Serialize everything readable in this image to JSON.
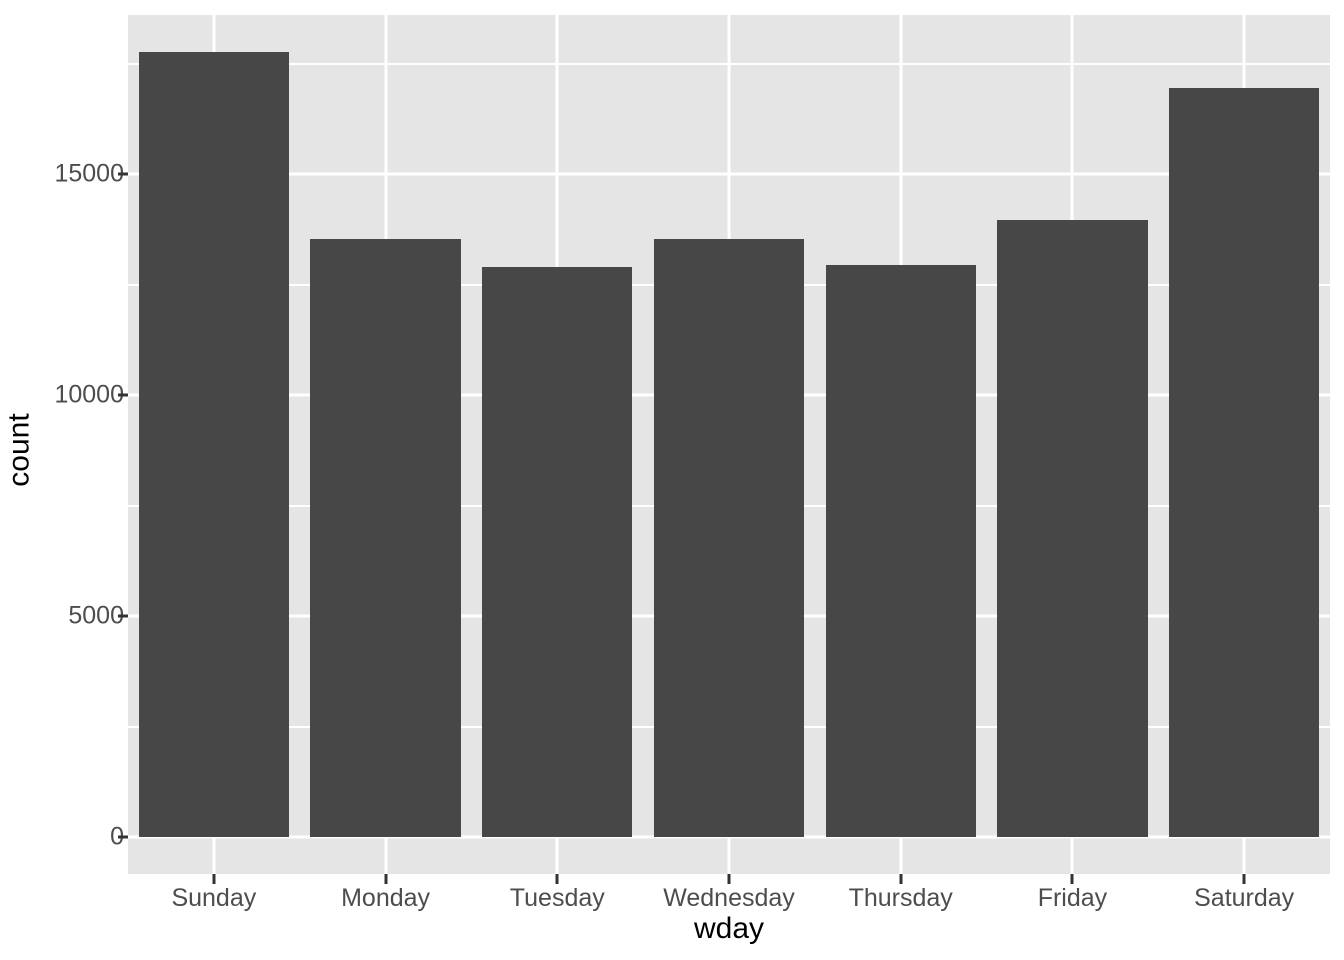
{
  "chart_data": {
    "type": "bar",
    "title": "",
    "subtitle": "",
    "xlabel": "wday",
    "ylabel": "count",
    "categories": [
      "Sunday",
      "Monday",
      "Tuesday",
      "Wednesday",
      "Thursday",
      "Friday",
      "Saturday"
    ],
    "values": [
      17750,
      13530,
      12900,
      13530,
      12940,
      13960,
      16950
    ],
    "ylim": [
      0,
      18750
    ],
    "xlim": [
      0,
      7
    ],
    "y_ticks": [
      0,
      5000,
      10000,
      15000
    ],
    "y_tick_labels": [
      "0",
      "5000",
      "10000",
      "15000"
    ],
    "y_minor_ticks": [
      2500,
      7500,
      12500,
      17500
    ],
    "grid": true,
    "legend": false,
    "legend_position": "none",
    "bar_color": "#474747",
    "panel_background": "#e5e5e5",
    "grid_color": "#ffffff",
    "plot_background": "#ffffff",
    "axis_text_color": "#4d4d4d",
    "axis_title_color": "#000000"
  }
}
